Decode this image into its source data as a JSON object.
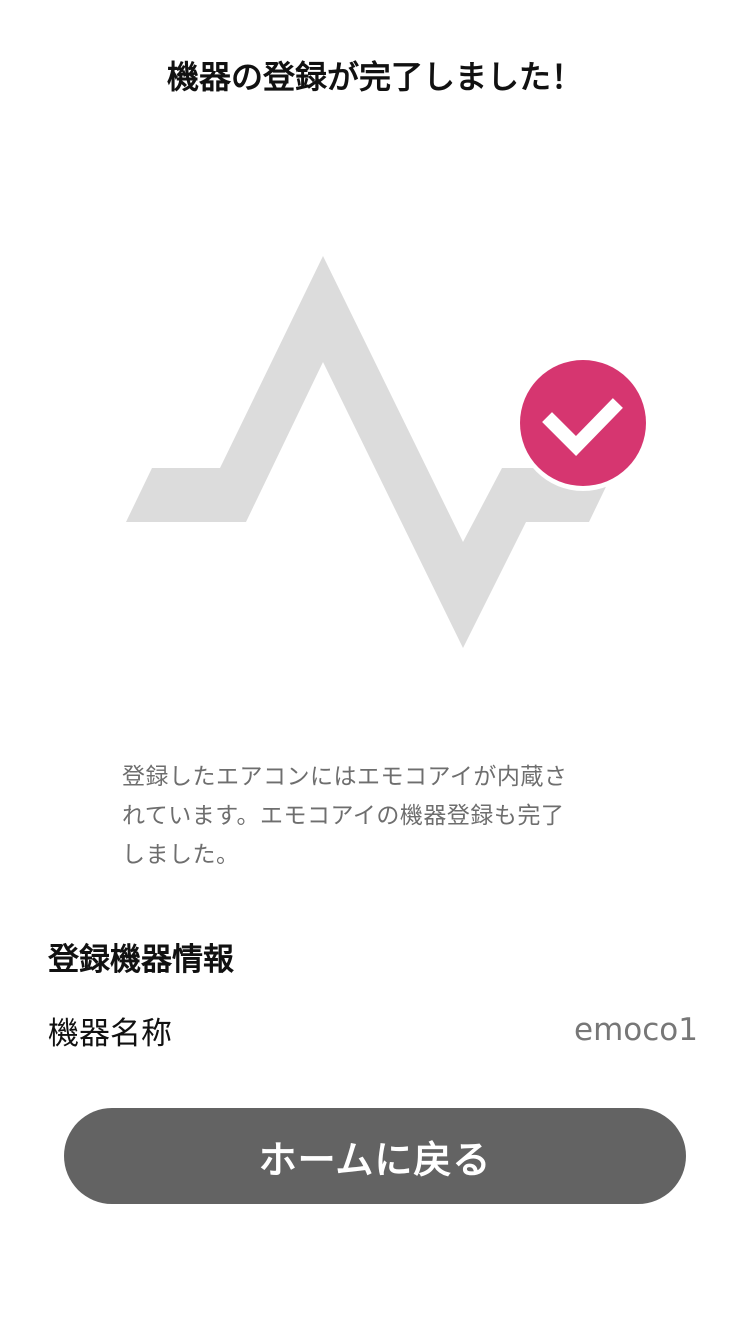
{
  "header": {
    "title": "機器の登録が完了しました！"
  },
  "illustration": {
    "icon": "pulse-wave-icon",
    "badge_icon": "checkmark-icon",
    "badge_color": "#d63670",
    "wave_color": "#dcdcdc"
  },
  "description": {
    "line1": "登録したエアコンにはエモコアイが内蔵さ",
    "line2": "れています。エモコアイの機器登録も完了",
    "line3": "しました。"
  },
  "device_info": {
    "heading": "登録機器情報",
    "name_label": "機器名称",
    "name_value": "emoco1"
  },
  "actions": {
    "home_button_label": "ホームに戻る",
    "button_color": "#636363"
  }
}
